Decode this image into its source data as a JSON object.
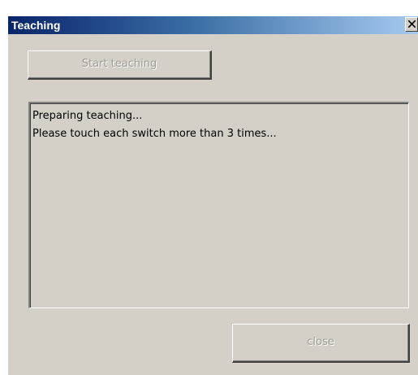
{
  "window": {
    "title": "Teaching",
    "close_glyph": "X"
  },
  "buttons": {
    "start_label": "Start teaching",
    "close_label": "close"
  },
  "log": {
    "lines": [
      "Preparing teaching...",
      "Please touch each switch more than 3 times..."
    ]
  },
  "icons": {
    "close": "close-icon"
  },
  "colors": {
    "titlebar_start": "#0a246a",
    "titlebar_end": "#a6caf0",
    "face": "#d4d0c8",
    "disabled_text": "#a09c94"
  }
}
